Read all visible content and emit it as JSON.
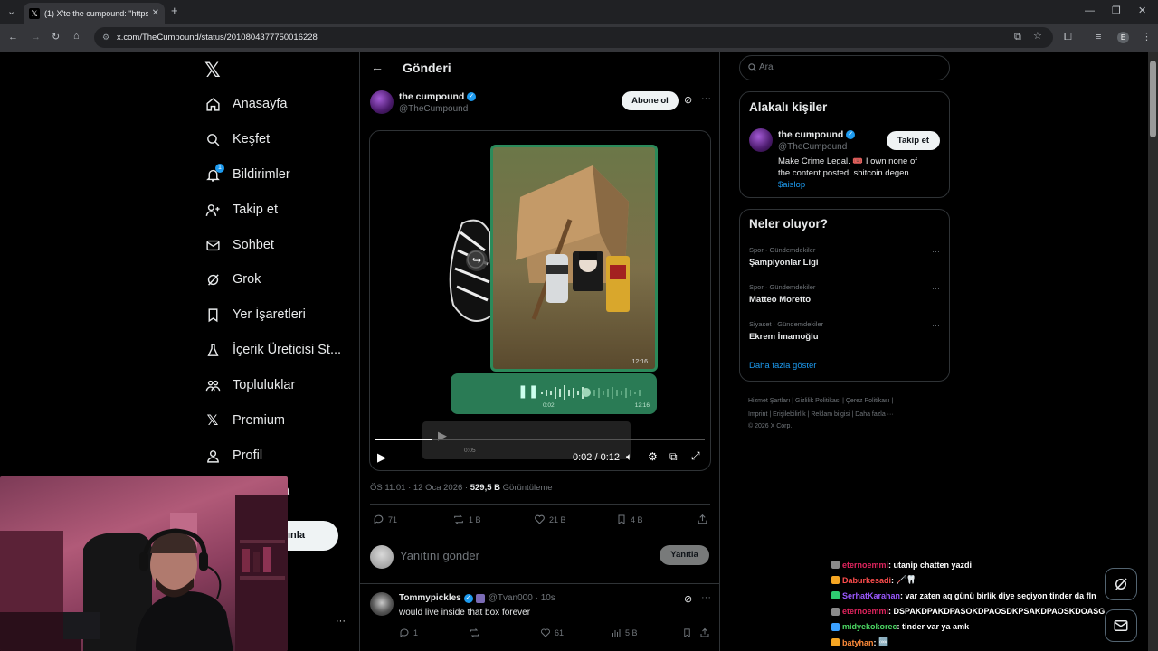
{
  "browser": {
    "tab_title": "(1) X'te the cumpound: \"https://",
    "url": "x.com/TheCumpound/status/2010804377750016228",
    "profile_initial": "E"
  },
  "nav": {
    "items": [
      {
        "label": "Anasayfa",
        "icon": "home-icon"
      },
      {
        "label": "Keşfet",
        "icon": "search-icon"
      },
      {
        "label": "Bildirimler",
        "icon": "bell-icon",
        "badge": "1"
      },
      {
        "label": "Takip et",
        "icon": "person-add-icon"
      },
      {
        "label": "Sohbet",
        "icon": "mail-icon"
      },
      {
        "label": "Grok",
        "icon": "grok-icon"
      },
      {
        "label": "Yer İşaretleri",
        "icon": "bookmark-icon"
      },
      {
        "label": "İçerik Üreticisi St...",
        "icon": "flask-icon"
      },
      {
        "label": "Topluluklar",
        "icon": "communities-icon"
      },
      {
        "label": "Premium",
        "icon": "x-icon"
      },
      {
        "label": "Profil",
        "icon": "profile-icon"
      }
    ],
    "partial_more_label": "a",
    "post_button_partial": "ınla"
  },
  "post": {
    "header_title": "Gönderi",
    "author_name": "the cumpound",
    "author_handle": "@TheCumpound",
    "subscribe_label": "Abone ol",
    "video": {
      "inner_time_top": "12:16",
      "inner_time_bottom": "12:16",
      "inner_voice_time": "0:02",
      "scrub_time": "0:05",
      "time_display": "0:02 / 0:12",
      "progress": 0.17
    },
    "timestamp": "ÖS 11:01 · 12 Oca 2026 · ",
    "views_count": "529,5 B",
    "views_label": " Görüntüleme",
    "stats": {
      "replies": "71",
      "reposts": "1 B",
      "likes": "21 B",
      "bookmarks": "4 B"
    },
    "reply_placeholder": "Yanıtını gönder",
    "reply_button": "Yanıtla"
  },
  "comment": {
    "name": "Tommypickles",
    "handle": "@Tvan000 · 10s",
    "text": "would live inside that box forever",
    "stats": {
      "replies": "1",
      "likes": "61",
      "views": "5 B"
    }
  },
  "right": {
    "search_placeholder": "Ara",
    "related_title": "Alakalı kişiler",
    "related_name": "the cumpound",
    "related_handle": "@TheCumpound",
    "follow_label": "Takip et",
    "bio_line1": "Make Crime Legal. 🎟️ I own none of",
    "bio_line2": "the content posted. shitcoin degen.",
    "bio_cashtag": "$aislop",
    "trends_title": "Neler oluyor?",
    "trends": [
      {
        "category": "Spor · Gündemdekiler",
        "name": "Şampiyonlar Ligi"
      },
      {
        "category": "Spor · Gündemdekiler",
        "name": "Matteo Moretto"
      },
      {
        "category": "Siyaset · Gündemdekiler",
        "name": "Ekrem İmamoğlu"
      }
    ],
    "show_more": "Daha fazla göster",
    "footer_line1": "Hizmet Şartları  |  Gizlilik Politikası  |  Çerez Politikası  |",
    "footer_line2": "Imprint  |  Erişilebilirlik  |  Reklam bilgisi  |  Daha fazla ···",
    "footer_line3": "© 2026 X Corp."
  },
  "chat": [
    {
      "user": "eternoemmi",
      "user_color": "#e0245e",
      "msg": "utanip chatten yazdi",
      "badge_color": "#8a8a8a"
    },
    {
      "user": "Daburkesadi",
      "user_color": "#ff4d4d",
      "msg": "🦯🦷",
      "badge_color": "#f5a623"
    },
    {
      "user": "SerhatKarahan",
      "user_color": "#9b59ff",
      "msg": "var zaten aq günü birlik diye seçiyon tinder da fln",
      "badge_color": "#2ecc71"
    },
    {
      "user": "eternoemmi",
      "user_color": "#e0245e",
      "msg": "DSPAKDPAKDPASOKDPAOSDKPSAKDPAOSKDOASG",
      "badge_color": "#8a8a8a"
    },
    {
      "user": "midyekokorec",
      "user_color": "#4cd964",
      "msg": "tinder var ya amk",
      "badge_color": "#3aa0ff"
    },
    {
      "user": "batyhan",
      "user_color": "#ff8c3a",
      "msg": "🆒",
      "badge_color": "#f5a623"
    }
  ],
  "colors": {
    "accent": "#1d9bf0",
    "background": "#000000",
    "border": "#2f3336",
    "muted": "#71767b"
  }
}
